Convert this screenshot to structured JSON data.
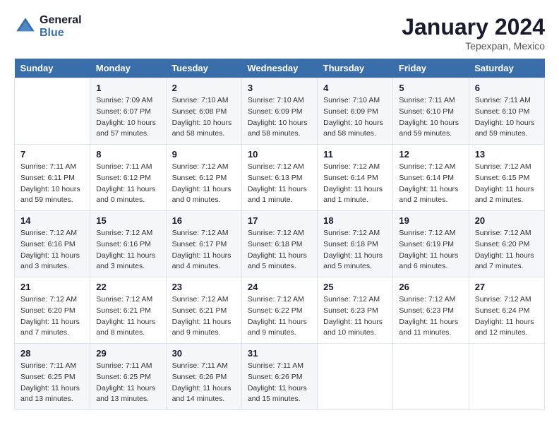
{
  "header": {
    "logo_line1": "General",
    "logo_line2": "Blue",
    "month": "January 2024",
    "location": "Tepexpan, Mexico"
  },
  "weekdays": [
    "Sunday",
    "Monday",
    "Tuesday",
    "Wednesday",
    "Thursday",
    "Friday",
    "Saturday"
  ],
  "weeks": [
    [
      {
        "day": "",
        "sunrise": "",
        "sunset": "",
        "daylight": ""
      },
      {
        "day": "1",
        "sunrise": "Sunrise: 7:09 AM",
        "sunset": "Sunset: 6:07 PM",
        "daylight": "Daylight: 10 hours and 57 minutes."
      },
      {
        "day": "2",
        "sunrise": "Sunrise: 7:10 AM",
        "sunset": "Sunset: 6:08 PM",
        "daylight": "Daylight: 10 hours and 58 minutes."
      },
      {
        "day": "3",
        "sunrise": "Sunrise: 7:10 AM",
        "sunset": "Sunset: 6:09 PM",
        "daylight": "Daylight: 10 hours and 58 minutes."
      },
      {
        "day": "4",
        "sunrise": "Sunrise: 7:10 AM",
        "sunset": "Sunset: 6:09 PM",
        "daylight": "Daylight: 10 hours and 58 minutes."
      },
      {
        "day": "5",
        "sunrise": "Sunrise: 7:11 AM",
        "sunset": "Sunset: 6:10 PM",
        "daylight": "Daylight: 10 hours and 59 minutes."
      },
      {
        "day": "6",
        "sunrise": "Sunrise: 7:11 AM",
        "sunset": "Sunset: 6:10 PM",
        "daylight": "Daylight: 10 hours and 59 minutes."
      }
    ],
    [
      {
        "day": "7",
        "sunrise": "Sunrise: 7:11 AM",
        "sunset": "Sunset: 6:11 PM",
        "daylight": "Daylight: 10 hours and 59 minutes."
      },
      {
        "day": "8",
        "sunrise": "Sunrise: 7:11 AM",
        "sunset": "Sunset: 6:12 PM",
        "daylight": "Daylight: 11 hours and 0 minutes."
      },
      {
        "day": "9",
        "sunrise": "Sunrise: 7:12 AM",
        "sunset": "Sunset: 6:12 PM",
        "daylight": "Daylight: 11 hours and 0 minutes."
      },
      {
        "day": "10",
        "sunrise": "Sunrise: 7:12 AM",
        "sunset": "Sunset: 6:13 PM",
        "daylight": "Daylight: 11 hours and 1 minute."
      },
      {
        "day": "11",
        "sunrise": "Sunrise: 7:12 AM",
        "sunset": "Sunset: 6:14 PM",
        "daylight": "Daylight: 11 hours and 1 minute."
      },
      {
        "day": "12",
        "sunrise": "Sunrise: 7:12 AM",
        "sunset": "Sunset: 6:14 PM",
        "daylight": "Daylight: 11 hours and 2 minutes."
      },
      {
        "day": "13",
        "sunrise": "Sunrise: 7:12 AM",
        "sunset": "Sunset: 6:15 PM",
        "daylight": "Daylight: 11 hours and 2 minutes."
      }
    ],
    [
      {
        "day": "14",
        "sunrise": "Sunrise: 7:12 AM",
        "sunset": "Sunset: 6:16 PM",
        "daylight": "Daylight: 11 hours and 3 minutes."
      },
      {
        "day": "15",
        "sunrise": "Sunrise: 7:12 AM",
        "sunset": "Sunset: 6:16 PM",
        "daylight": "Daylight: 11 hours and 3 minutes."
      },
      {
        "day": "16",
        "sunrise": "Sunrise: 7:12 AM",
        "sunset": "Sunset: 6:17 PM",
        "daylight": "Daylight: 11 hours and 4 minutes."
      },
      {
        "day": "17",
        "sunrise": "Sunrise: 7:12 AM",
        "sunset": "Sunset: 6:18 PM",
        "daylight": "Daylight: 11 hours and 5 minutes."
      },
      {
        "day": "18",
        "sunrise": "Sunrise: 7:12 AM",
        "sunset": "Sunset: 6:18 PM",
        "daylight": "Daylight: 11 hours and 5 minutes."
      },
      {
        "day": "19",
        "sunrise": "Sunrise: 7:12 AM",
        "sunset": "Sunset: 6:19 PM",
        "daylight": "Daylight: 11 hours and 6 minutes."
      },
      {
        "day": "20",
        "sunrise": "Sunrise: 7:12 AM",
        "sunset": "Sunset: 6:20 PM",
        "daylight": "Daylight: 11 hours and 7 minutes."
      }
    ],
    [
      {
        "day": "21",
        "sunrise": "Sunrise: 7:12 AM",
        "sunset": "Sunset: 6:20 PM",
        "daylight": "Daylight: 11 hours and 7 minutes."
      },
      {
        "day": "22",
        "sunrise": "Sunrise: 7:12 AM",
        "sunset": "Sunset: 6:21 PM",
        "daylight": "Daylight: 11 hours and 8 minutes."
      },
      {
        "day": "23",
        "sunrise": "Sunrise: 7:12 AM",
        "sunset": "Sunset: 6:21 PM",
        "daylight": "Daylight: 11 hours and 9 minutes."
      },
      {
        "day": "24",
        "sunrise": "Sunrise: 7:12 AM",
        "sunset": "Sunset: 6:22 PM",
        "daylight": "Daylight: 11 hours and 9 minutes."
      },
      {
        "day": "25",
        "sunrise": "Sunrise: 7:12 AM",
        "sunset": "Sunset: 6:23 PM",
        "daylight": "Daylight: 11 hours and 10 minutes."
      },
      {
        "day": "26",
        "sunrise": "Sunrise: 7:12 AM",
        "sunset": "Sunset: 6:23 PM",
        "daylight": "Daylight: 11 hours and 11 minutes."
      },
      {
        "day": "27",
        "sunrise": "Sunrise: 7:12 AM",
        "sunset": "Sunset: 6:24 PM",
        "daylight": "Daylight: 11 hours and 12 minutes."
      }
    ],
    [
      {
        "day": "28",
        "sunrise": "Sunrise: 7:11 AM",
        "sunset": "Sunset: 6:25 PM",
        "daylight": "Daylight: 11 hours and 13 minutes."
      },
      {
        "day": "29",
        "sunrise": "Sunrise: 7:11 AM",
        "sunset": "Sunset: 6:25 PM",
        "daylight": "Daylight: 11 hours and 13 minutes."
      },
      {
        "day": "30",
        "sunrise": "Sunrise: 7:11 AM",
        "sunset": "Sunset: 6:26 PM",
        "daylight": "Daylight: 11 hours and 14 minutes."
      },
      {
        "day": "31",
        "sunrise": "Sunrise: 7:11 AM",
        "sunset": "Sunset: 6:26 PM",
        "daylight": "Daylight: 11 hours and 15 minutes."
      },
      {
        "day": "",
        "sunrise": "",
        "sunset": "",
        "daylight": ""
      },
      {
        "day": "",
        "sunrise": "",
        "sunset": "",
        "daylight": ""
      },
      {
        "day": "",
        "sunrise": "",
        "sunset": "",
        "daylight": ""
      }
    ]
  ]
}
